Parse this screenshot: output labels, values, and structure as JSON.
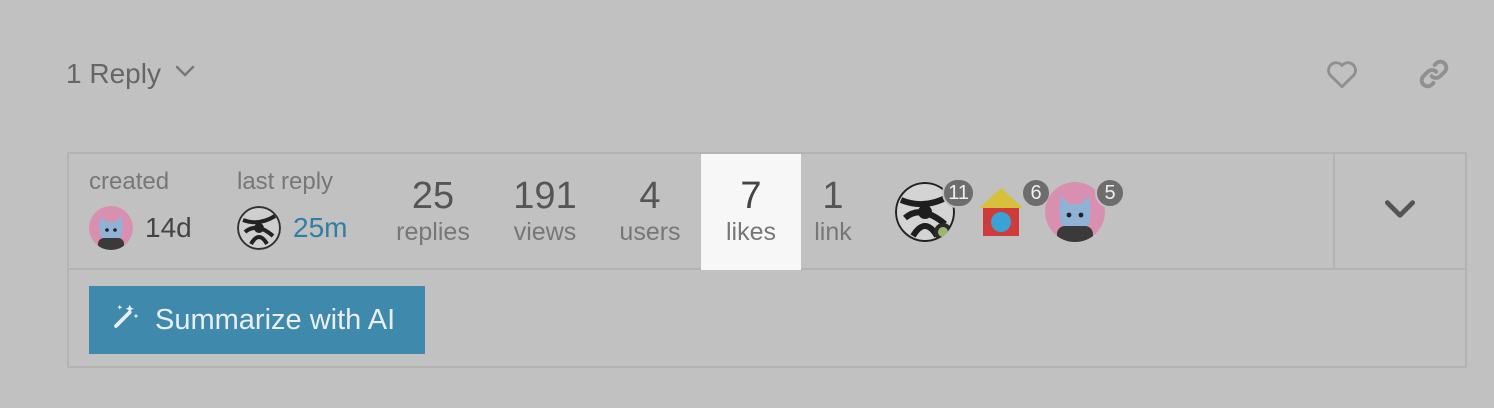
{
  "reply_toggle": {
    "label": "1 Reply",
    "icon": "chevron-down-icon"
  },
  "top_actions": {
    "like_icon": "heart-icon",
    "share_icon": "link-icon"
  },
  "topic_map": {
    "created": {
      "label": "created",
      "value": "14d"
    },
    "last_reply": {
      "label": "last reply",
      "value": "25m"
    },
    "stats": [
      {
        "number": "25",
        "label": "replies"
      },
      {
        "number": "191",
        "label": "views"
      },
      {
        "number": "4",
        "label": "users"
      },
      {
        "number": "7",
        "label": "likes"
      },
      {
        "number": "1",
        "label": "link"
      }
    ],
    "participants": [
      {
        "count": "11"
      },
      {
        "count": "6"
      },
      {
        "count": "5"
      }
    ],
    "expand_icon": "chevron-down-icon",
    "summarize_button": {
      "label": "Summarize with AI",
      "icon": "magic-wand-icon"
    }
  },
  "colors": {
    "background": "#c1c1c1",
    "accent": "#3f89ac",
    "link": "#2f7ea6",
    "highlight": "#f7f7f7"
  }
}
